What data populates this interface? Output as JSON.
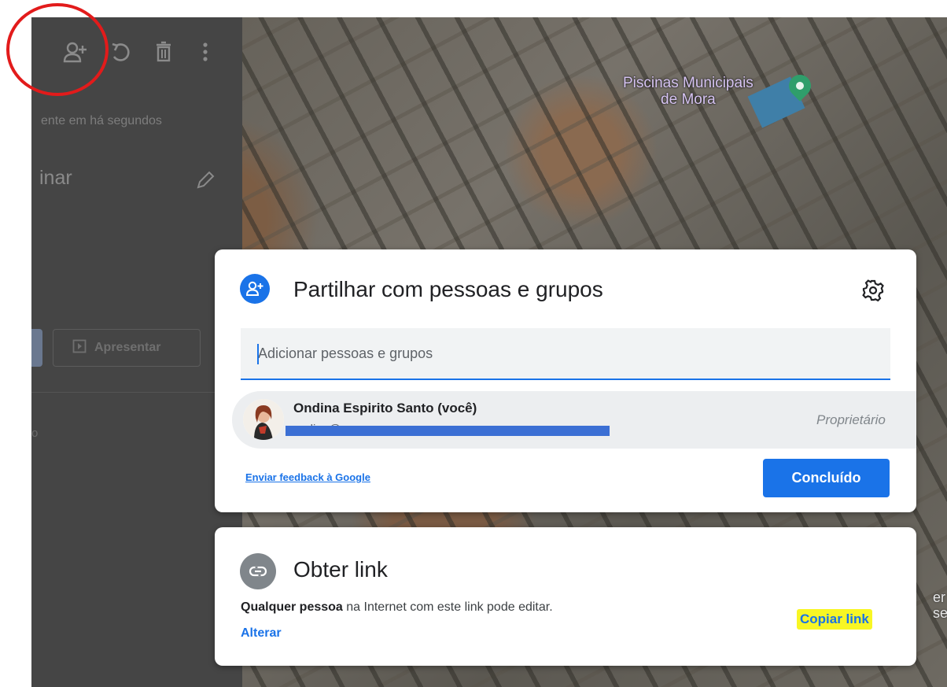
{
  "map": {
    "place_label_line1": "Piscinas Municipais",
    "place_label_line2": "de Mora",
    "edge_frag_1": "er",
    "edge_frag_2": "se"
  },
  "left_panel": {
    "subtitle": "ente em há segundos",
    "title": "inar",
    "present_label": "Apresentar",
    "fragment": "o"
  },
  "share_dialog": {
    "title": "Partilhar com pessoas e grupos",
    "input_placeholder": "Adicionar pessoas e grupos",
    "owner": {
      "name": "Ondina Espirito Santo (você)",
      "email": "ondina@…",
      "role": "Proprietário"
    },
    "feedback_link": "Enviar feedback à Google",
    "done_label": "Concluído"
  },
  "link_dialog": {
    "title": "Obter link",
    "desc_bold": "Qualquer pessoa",
    "desc_rest": " na Internet com este link pode editar.",
    "change_label": "Alterar",
    "copy_label": "Copiar link"
  },
  "colors": {
    "accent": "#1a73e8",
    "highlight": "#f8f624",
    "annotation": "#e21b1b"
  },
  "icons": [
    "add-person-icon",
    "undo-icon",
    "trash-icon",
    "more-vert-icon",
    "pencil-icon",
    "present-icon",
    "settings-gear-icon",
    "link-icon",
    "map-pin-icon"
  ]
}
